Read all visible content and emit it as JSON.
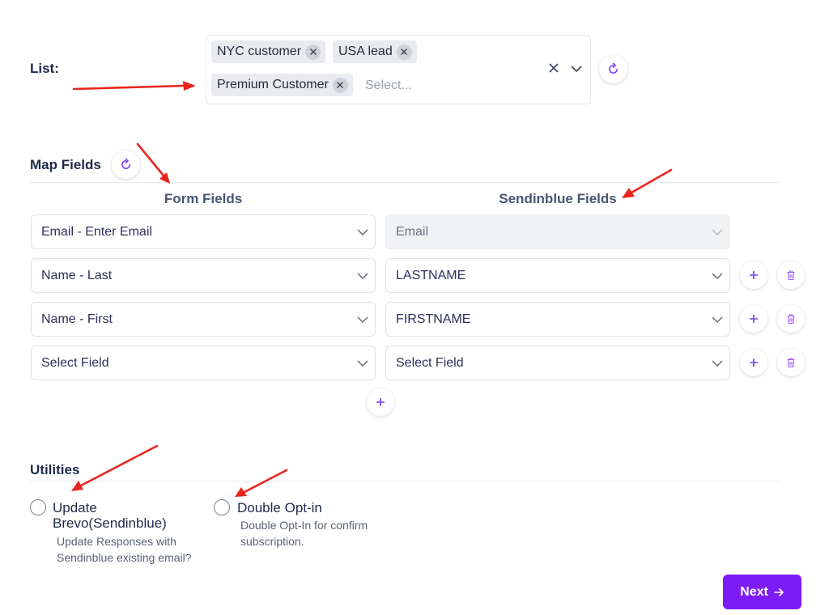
{
  "list": {
    "label": "List:",
    "chips": [
      "NYC customer",
      "USA lead",
      "Premium Customer"
    ],
    "placeholder": "Select..."
  },
  "map_fields": {
    "title": "Map Fields",
    "form_fields_header": "Form Fields",
    "sendinblue_fields_header": "Sendinblue Fields",
    "rows": [
      {
        "form_field": "Email - Enter Email",
        "sendinblue_field": "Email",
        "disabled": true
      },
      {
        "form_field": "Name - Last",
        "sendinblue_field": "LASTNAME",
        "disabled": false
      },
      {
        "form_field": "Name - First",
        "sendinblue_field": "FIRSTNAME",
        "disabled": false
      },
      {
        "form_field": "Select Field",
        "sendinblue_field": "Select Field",
        "disabled": false
      }
    ]
  },
  "utilities": {
    "title": "Utilities",
    "options": [
      {
        "title": "Update Brevo(Sendinblue)",
        "description": "Update Responses with Sendinblue existing email?",
        "checked": false
      },
      {
        "title": "Double Opt-in",
        "description": "Double Opt-In for confirm subscription.",
        "checked": false
      }
    ]
  },
  "next_button": {
    "label": "Next"
  },
  "colors": {
    "accent": "#7c1cf5",
    "heading": "#1e2b4a",
    "annotation_arrow": "#e8261f"
  },
  "icons": [
    "refresh-icon",
    "close-icon",
    "chevron-down-icon",
    "plus-icon",
    "trash-icon",
    "arrow-right-icon"
  ]
}
